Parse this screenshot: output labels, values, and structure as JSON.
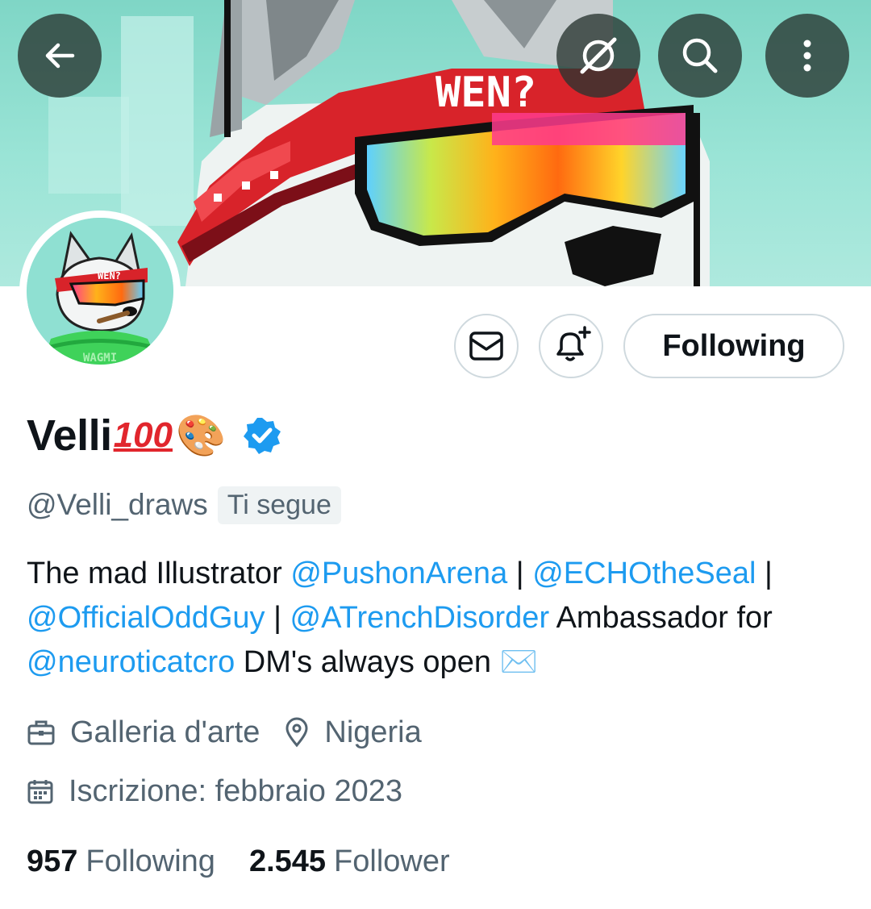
{
  "header": {
    "back_icon": "arrow-left-icon",
    "grok_icon": "grok-slash-icon",
    "search_icon": "search-icon",
    "more_icon": "more-vertical-icon",
    "banner_text": "WEN?"
  },
  "avatar": {
    "cap_text": "WEN?",
    "shirt_text": "WAGMI"
  },
  "actions": {
    "message_icon": "envelope-icon",
    "notify_icon": "bell-plus-icon",
    "following_label": "Following"
  },
  "profile": {
    "name": "Velli",
    "emoji_100": "100",
    "emoji_palette": "🎨",
    "verified_icon": "verified-badge-icon",
    "handle": "@Velli_draws",
    "follows_you": "Ti segue"
  },
  "bio": {
    "part1": "The mad Illustrator ",
    "mention1": "@PushonArena",
    "sep1": " | ",
    "mention2": "@ECHOtheSeal",
    "sep2": " | ",
    "mention3": "@OfficialOddGuy",
    "sep3": " | ",
    "mention4": "@ATrenchDisorder",
    "part2": " Ambassador for ",
    "mention5": "@neuroticatcro",
    "part3": " DM's always open ",
    "envelope_emoji": "✉️"
  },
  "meta": {
    "category_icon": "briefcase-icon",
    "category": "Galleria d'arte",
    "location_icon": "location-pin-icon",
    "location": "Nigeria",
    "joined_icon": "calendar-icon",
    "joined": "Iscrizione: febbraio 2023"
  },
  "stats": {
    "following_count": "957",
    "following_label": "Following",
    "followers_count": "2.545",
    "followers_label": "Follower"
  },
  "colors": {
    "accent": "#1d9bf0",
    "banner_bg": "#9ae4d6",
    "text_primary": "#0f1419",
    "text_secondary": "#536471"
  }
}
